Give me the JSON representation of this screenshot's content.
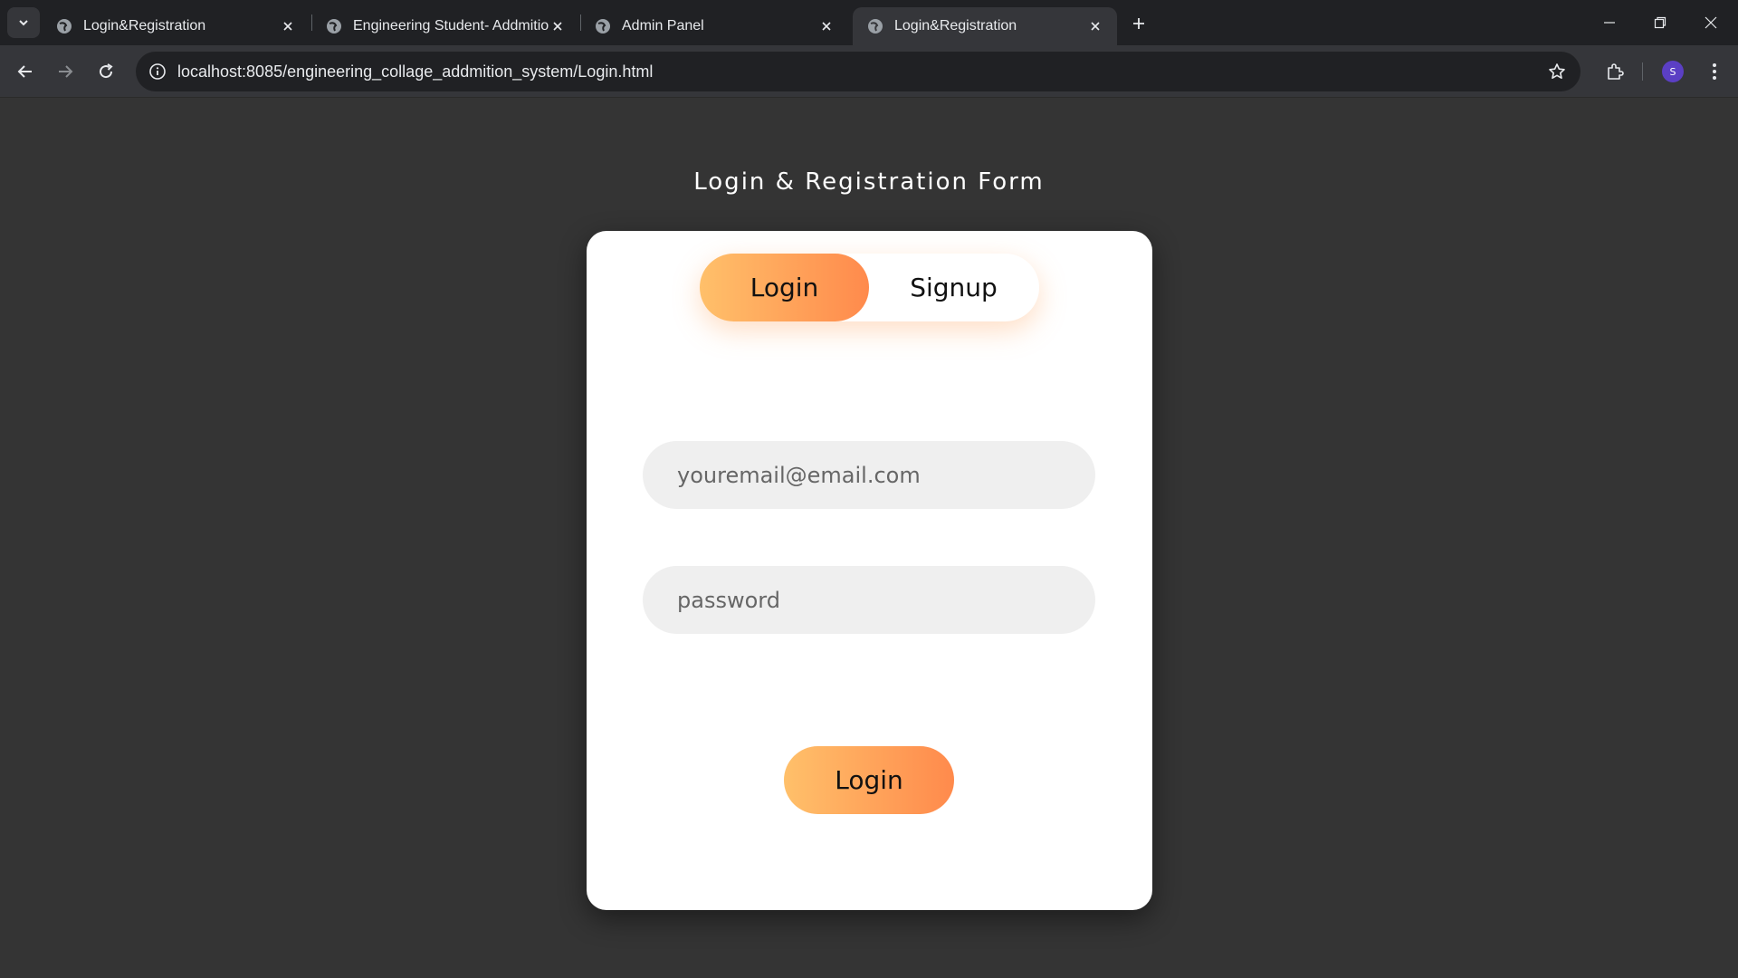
{
  "browser": {
    "tabs": [
      {
        "title": "Login&Registration",
        "active": false
      },
      {
        "title": "Engineering Student- Addmition",
        "active": false
      },
      {
        "title": "Admin Panel",
        "active": false
      },
      {
        "title": "Login&Registration",
        "active": true
      }
    ],
    "url": "localhost:8085/engineering_collage_addmition_system/Login.html",
    "profile_initial": "S"
  },
  "page": {
    "title": "Login & Registration Form",
    "toggle": {
      "login_label": "Login",
      "signup_label": "Signup",
      "selected": "Login"
    },
    "email_placeholder": "youremail@email.com",
    "password_placeholder": "password",
    "submit_label": "Login"
  },
  "colors": {
    "page_bg": "#343434",
    "accent_start": "#ffc06a",
    "accent_end": "#ff8a4c",
    "avatar": "#5b3fc4"
  }
}
